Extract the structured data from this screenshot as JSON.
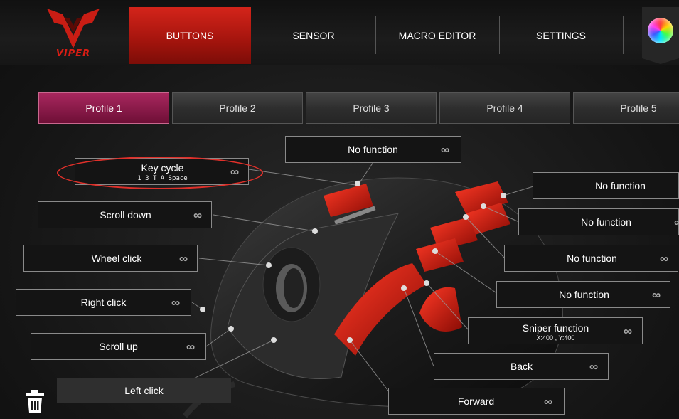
{
  "logo": {
    "text": "VIPER"
  },
  "nav": {
    "tabs": [
      {
        "label": "BUTTONS",
        "active": true
      },
      {
        "label": "SENSOR",
        "active": false
      },
      {
        "label": "MACRO EDITOR",
        "active": false
      },
      {
        "label": "SETTINGS",
        "active": false
      }
    ]
  },
  "profiles": [
    "Profile 1",
    "Profile 2",
    "Profile 3",
    "Profile 4",
    "Profile 5"
  ],
  "active_profile": "Profile 1",
  "buttons": {
    "top": "No function",
    "key_cycle": {
      "label": "Key cycle",
      "keys": "1 3 T A Space"
    },
    "scroll_down": "Scroll down",
    "wheel_click": "Wheel click",
    "right_click": "Right click",
    "scroll_up": "Scroll up",
    "left_click": "Left click",
    "side1": "No function",
    "side2": "No function",
    "side3": "No function",
    "side4": "No function",
    "sniper": {
      "label": "Sniper function",
      "detail": "X:400 , Y:400"
    },
    "back": "Back",
    "forward": "Forward"
  },
  "link_symbol": "∞",
  "icons": [
    "infinity-link-icon",
    "trash-icon",
    "color-wheel-icon"
  ],
  "colors": {
    "accent_red": "#c91d14",
    "profile_active": "#8b1a47"
  }
}
